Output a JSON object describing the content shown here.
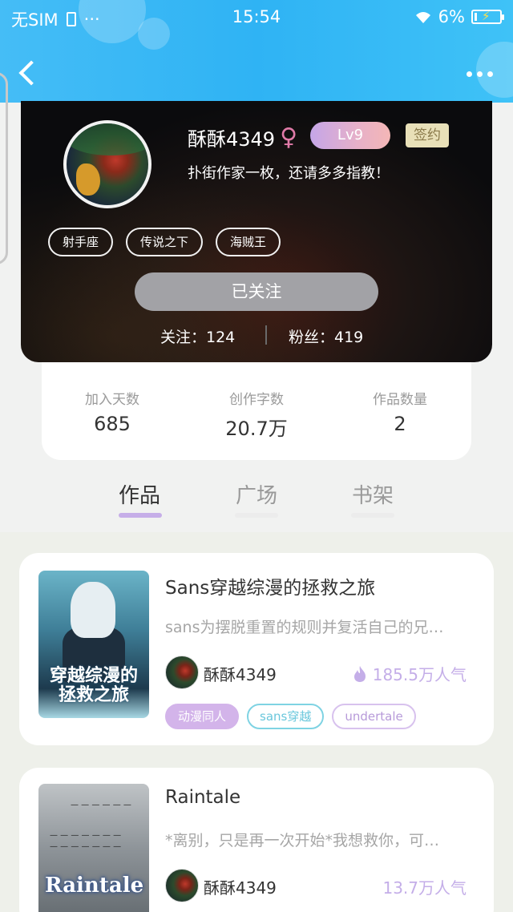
{
  "status_bar": {
    "carrier": "无SIM",
    "time": "15:54",
    "battery": "6%"
  },
  "profile": {
    "username": "酥酥4349",
    "gender_symbol": "♀",
    "level": "Lv9",
    "signed_badge": "签约",
    "bio": "扑街作家一枚，还请多多指教！",
    "tags": [
      "射手座",
      "传说之下",
      "海贼王"
    ],
    "follow_button": "已关注",
    "following": "关注：124",
    "fans": "粉丝：419"
  },
  "stats": [
    {
      "label": "加入天数",
      "value": "685"
    },
    {
      "label": "创作字数",
      "value": "20.7万"
    },
    {
      "label": "作品数量",
      "value": "2"
    }
  ],
  "tabs": [
    {
      "label": "作品",
      "active": true
    },
    {
      "label": "广场",
      "active": false
    },
    {
      "label": "书架",
      "active": false
    }
  ],
  "books": [
    {
      "title": "Sans穿越综漫的拯救之旅",
      "cover_text": "穿越综漫的拯救之旅",
      "desc": "sans为摆脱重置的规则并复活自己的兄…",
      "author": "酥酥4349",
      "popularity": "185.5万人气",
      "tags": [
        "动漫同人",
        "sans穿越",
        "undertale"
      ]
    },
    {
      "title": "Raintale",
      "cover_text": "Raintale",
      "desc": "*离别，只是再一次开始*我想救你，可…",
      "author": "酥酥4349",
      "popularity": "13.7万人气",
      "tags": []
    }
  ],
  "colors": {
    "header_blue": "#2fb3f4",
    "accent_purple": "#c6aee8",
    "follow_gray": "#a2a2a6"
  }
}
